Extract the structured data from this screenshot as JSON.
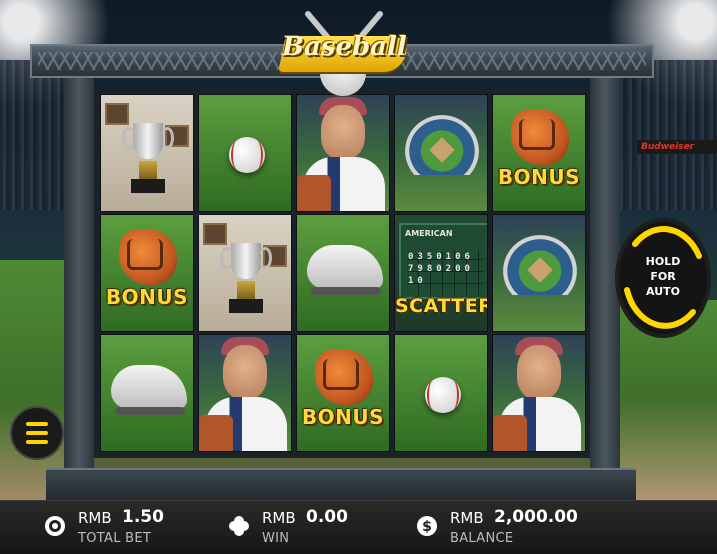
{
  "game": {
    "logo_text": "Baseball"
  },
  "reels": {
    "grid": [
      [
        "trophy",
        "glove-bonus",
        "shoe"
      ],
      [
        "ball",
        "trophy",
        "player"
      ],
      [
        "player",
        "shoe",
        "glove-bonus"
      ],
      [
        "stadium",
        "scoreboard-scatter",
        "ball"
      ],
      [
        "glove-bonus",
        "stadium",
        "player"
      ]
    ],
    "bonus_label": "BONUS",
    "scatter_label": "SCATTER",
    "scoreboard_rows": [
      "AMERICAN",
      "0350106",
      "7980200",
      "10"
    ]
  },
  "scenery": {
    "billboard_text": "Budweiser"
  },
  "auto_button": {
    "line1": "HOLD",
    "line2": "FOR",
    "line3": "AUTO"
  },
  "bottom_bar": {
    "total_bet": {
      "currency": "RMB",
      "value": "1.50",
      "label": "TOTAL BET",
      "icon": "chip-icon"
    },
    "win": {
      "currency": "RMB",
      "value": "0.00",
      "label": "WIN",
      "icon": "clover-icon"
    },
    "balance": {
      "currency": "RMB",
      "value": "2,000.00",
      "label": "BALANCE",
      "icon": "dollar-icon"
    }
  },
  "colors": {
    "accent": "#ffd400",
    "symbol_text": "#ffd93a"
  }
}
